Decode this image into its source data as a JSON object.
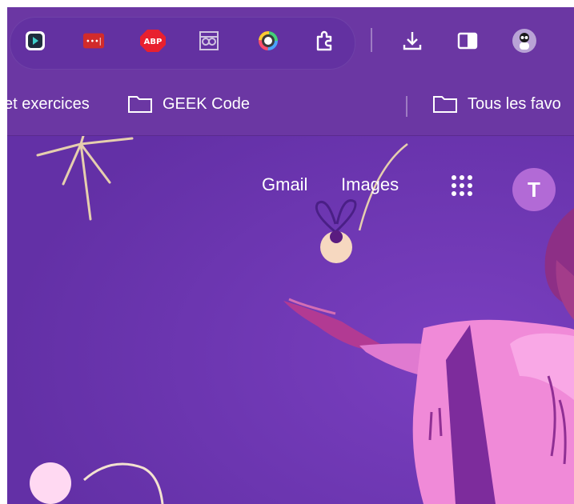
{
  "toolbar": {
    "extensions": [
      {
        "name": "Readlang",
        "icon": "play-arrow"
      },
      {
        "name": "Password dots",
        "label": "•••|",
        "color": "#d22b2b"
      },
      {
        "name": "AdBlock Plus",
        "label": "ABP",
        "color": "#e8202f"
      },
      {
        "name": "Reader",
        "icon": "glasses"
      },
      {
        "name": "Color ring",
        "icon": "ring"
      },
      {
        "name": "Extensions",
        "icon": "puzzle"
      }
    ],
    "actions": [
      {
        "name": "Downloads",
        "icon": "download"
      },
      {
        "name": "Side panel",
        "icon": "side-panel"
      },
      {
        "name": "Profile",
        "icon": "profile-avatar"
      }
    ]
  },
  "bookmarks": {
    "items": [
      {
        "label": "et exercices"
      },
      {
        "label": "GEEK Code"
      }
    ],
    "all_bookmarks": "Tous les favo"
  },
  "google": {
    "gmail": "Gmail",
    "images": "Images",
    "avatar_letter": "T"
  },
  "colors": {
    "background": "#6b35ad",
    "toolbar": "#6b37a3",
    "avatar": "#b26ad6",
    "hoodie": "#f08ad8"
  }
}
